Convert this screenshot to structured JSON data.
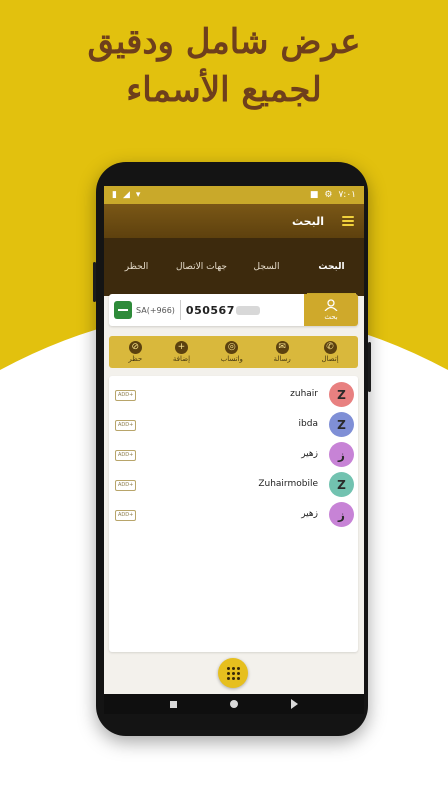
{
  "headline": {
    "line1": "عرض شامل ودقيق",
    "line2": "لجميع الأسماء"
  },
  "colors": {
    "accent": "#cfa92b",
    "brown": "#5e410e",
    "bg_yellow": "#e2c10e"
  },
  "statusbar": {
    "time": "٧:٠١"
  },
  "appbar": {
    "title": "البحث",
    "menu_icon": "menu-icon"
  },
  "tabs": [
    {
      "label": "البحث",
      "active": true
    },
    {
      "label": "السجل"
    },
    {
      "label": "جهات الاتصال"
    },
    {
      "label": "الحظر"
    }
  ],
  "search": {
    "country_code": "SA(+966)",
    "number": "050567",
    "button_label": "بحث",
    "flag_icon": "saudi-flag-icon"
  },
  "actions": [
    {
      "label": "إتصال",
      "icon": "phone-icon",
      "glyph": "✆"
    },
    {
      "label": "رسالة",
      "icon": "message-icon",
      "glyph": "✉"
    },
    {
      "label": "واتساب",
      "icon": "whatsapp-icon",
      "glyph": "◎"
    },
    {
      "label": "إضافة",
      "icon": "plus-icon",
      "glyph": "+"
    },
    {
      "label": "حظر",
      "icon": "block-icon",
      "glyph": "⊘"
    }
  ],
  "contacts": [
    {
      "name": "zuhair",
      "initial": "Z",
      "color": "#e88080",
      "add_label": "ADD+"
    },
    {
      "name": "ibda",
      "initial": "Z",
      "color": "#7f8fd6",
      "add_label": "ADD+"
    },
    {
      "name": "زهير",
      "initial": "ز",
      "color": "#c783d6",
      "add_label": "ADD+"
    },
    {
      "name": "Zuhairmobile",
      "initial": "Z",
      "color": "#72c2b0",
      "add_label": "ADD+"
    },
    {
      "name": "زهير",
      "initial": "ز",
      "color": "#c783d6",
      "add_label": "ADD+"
    }
  ]
}
